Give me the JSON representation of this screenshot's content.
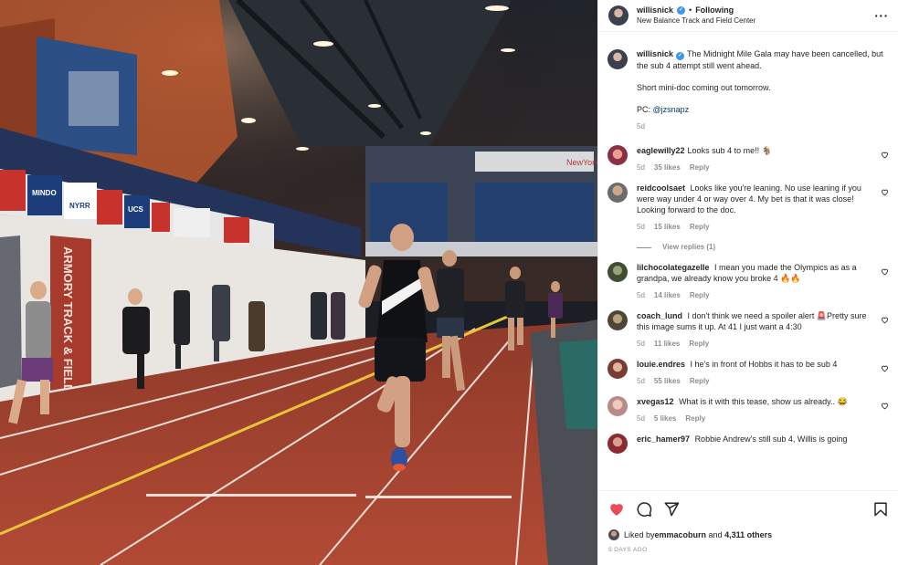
{
  "post": {
    "owner": "willisnick",
    "following_label": "Following",
    "separator": "•",
    "location": "New Balance Track and Field Center",
    "more_icon": "more-horizontal-icon",
    "caption": {
      "line1": "The Midnight Mile Gala may have been cancelled, but the sub 4 attempt still went ahead.",
      "line2": "Short mini-doc coming out tomorrow.",
      "pc_prefix": "PC: ",
      "pc_mention": "@jzsnapz",
      "age": "5d"
    },
    "photo": {
      "banner_labels": [
        "MINDO",
        "NYRR",
        "UCS"
      ],
      "wall_text": "ARMORY TRACK & FIELD",
      "arena_sign": "NewYork"
    }
  },
  "comments": [
    {
      "user": "eaglewilly22",
      "text": "Looks sub 4 to me!! 🐐",
      "age": "5d",
      "likes": "35 likes",
      "reply": "Reply",
      "view_replies": ""
    },
    {
      "user": "reidcoolsaet",
      "text": "Looks like you're leaning. No use leaning if you were way under 4 or way over 4. My bet is that it was close! Looking forward to the doc.",
      "age": "5d",
      "likes": "15 likes",
      "reply": "Reply",
      "view_replies": "View replies (1)"
    },
    {
      "user": "lilchocolategazelle",
      "text": "I mean you made the Olympics as as a grandpa, we already know you broke 4 🔥🔥",
      "age": "5d",
      "likes": "14 likes",
      "reply": "Reply",
      "view_replies": ""
    },
    {
      "user": "coach_lund",
      "text": "I don't think we need a spoiler alert 🚨Pretty sure this image sums it up. At 41 I just want a 4:30",
      "age": "5d",
      "likes": "11 likes",
      "reply": "Reply",
      "view_replies": ""
    },
    {
      "user": "louie.endres",
      "text": "I he's in front of Hobbs it has to be sub 4",
      "age": "5d",
      "likes": "55 likes",
      "reply": "Reply",
      "view_replies": ""
    },
    {
      "user": "xvegas12",
      "text": "What is it with this tease, show us already.. 😂",
      "age": "5d",
      "likes": "5 likes",
      "reply": "Reply",
      "view_replies": ""
    },
    {
      "user": "eric_hamer97",
      "text": "Robbie Andrew's still sub 4, Willis is going",
      "age": "",
      "likes": "",
      "reply": "",
      "view_replies": ""
    }
  ],
  "actions": {
    "icons": [
      "heart-filled-icon",
      "comment-icon",
      "share-icon",
      "bookmark-icon"
    ],
    "liked_by_prefix": "Liked by ",
    "liked_by_user": "emmacoburn",
    "liked_by_and": " and ",
    "liked_by_others": "4,311 others",
    "date": "5 DAYS AGO"
  },
  "colors": {
    "like_red": "#ed4956",
    "verified_blue": "#3897f0",
    "mention_blue": "#00376b",
    "muted_gray": "#8e8e8e",
    "track_red": "#a8442e"
  }
}
